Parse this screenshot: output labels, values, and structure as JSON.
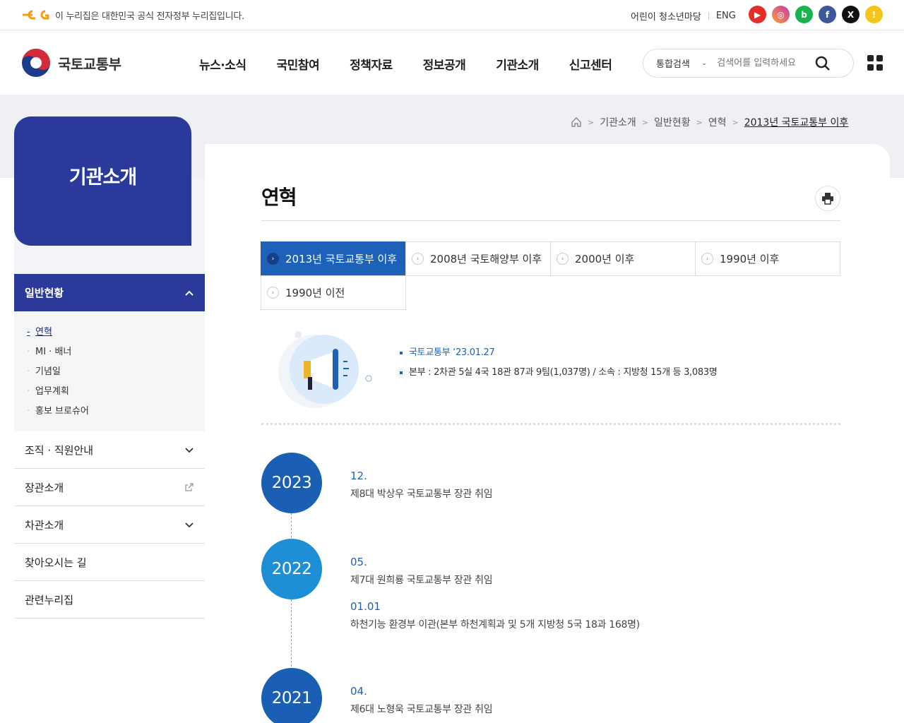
{
  "topbar": {
    "gov_notice": "이 누리집은 대한민국 공식 전자정부 누리집입니다.",
    "kids_link": "어린이 청소년마당",
    "eng_link": "ENG",
    "sns": [
      {
        "name": "youtube",
        "color": "#e52d27"
      },
      {
        "name": "instagram",
        "color": "#c837ab"
      },
      {
        "name": "blog",
        "color": "#19b34f"
      },
      {
        "name": "facebook",
        "color": "#3b5998"
      },
      {
        "name": "x",
        "color": "#111111"
      },
      {
        "name": "kakao",
        "color": "#f5c518"
      }
    ]
  },
  "header": {
    "logo_text": "국토교통부",
    "gnb": [
      "뉴스·소식",
      "국민참여",
      "정책자료",
      "정보공개",
      "기관소개",
      "신고센터"
    ],
    "search_scope": "통합검색",
    "search_placeholder": "검색어를 입력하세요"
  },
  "breadcrumb": [
    "기관소개",
    "일반현황",
    "연혁",
    "2013년 국토교통부 이후"
  ],
  "sidebar": {
    "title": "기관소개",
    "active_group": "일반현황",
    "sub_items": [
      "연혁",
      "MI · 배너",
      "기념일",
      "업무계획",
      "홍보 브로슈어"
    ],
    "items": [
      "조직 · 직원안내",
      "장관소개",
      "차관소개",
      "찾아오시는 길",
      "관련누리집"
    ]
  },
  "page": {
    "title": "연혁",
    "tabs": [
      "2013년 국토교통부 이후",
      "2008년 국토해양부 이후",
      "2000년 이후",
      "1990년 이후",
      "1990년 이전"
    ],
    "active_tab": 0,
    "summary": [
      "국토교통부 ‘23.01.27",
      "본부 : 2차관 5실 4국 18관 87과 9팀(1,037명) / 소속 : 지방청 15개 등 3,083명"
    ]
  },
  "timeline": [
    {
      "year": "2023",
      "color": "#1a5fb4",
      "events": [
        {
          "date": "12.",
          "text": "제8대 박상우 국토교통부 장관 취임"
        }
      ]
    },
    {
      "year": "2022",
      "color": "#1e8fd6",
      "events": [
        {
          "date": "05.",
          "text": "제7대 원희룡 국토교통부 장관 취임"
        },
        {
          "date": "01.01",
          "text": "하천기능 환경부 이관(본부 하천계획과 및 5개 지방청 5국 18과 168명)"
        }
      ]
    },
    {
      "year": "2021",
      "color": "#1a5fb4",
      "events": [
        {
          "date": "04.",
          "text": "제6대 노형욱 국토교통부 장관 취임"
        }
      ]
    }
  ]
}
